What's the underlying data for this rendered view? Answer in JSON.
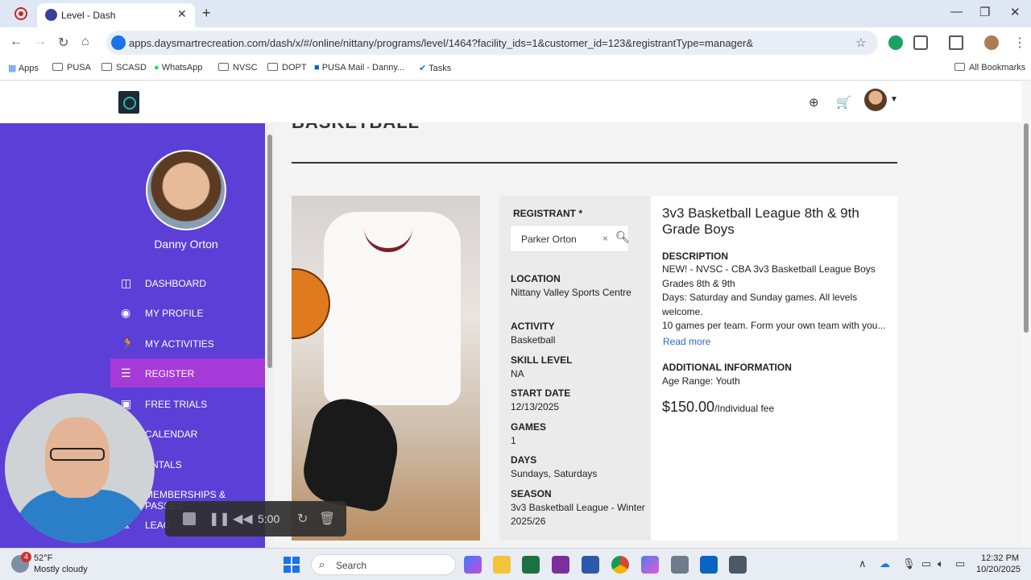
{
  "browser": {
    "tab_title": "Level - Dash",
    "url": "apps.daysmartrecreation.com/dash/x/#/online/nittany/programs/level/1464?facility_ids=1&customer_id=123&registrantType=manager&",
    "bookmarks": [
      "Apps",
      "PUSA",
      "SCASD",
      "WhatsApp",
      "NVSC",
      "DOPT",
      "PUSA Mail - Danny...",
      "Tasks"
    ],
    "all_bookmarks": "All Bookmarks"
  },
  "sidebar": {
    "user_name": "Danny Orton",
    "items": [
      {
        "label": "DASHBOARD"
      },
      {
        "label": "MY PROFILE"
      },
      {
        "label": "MY ACTIVITIES"
      },
      {
        "label": "REGISTER"
      },
      {
        "label": "FREE TRIALS"
      },
      {
        "label": "CALENDAR"
      },
      {
        "label": "ENTALS"
      },
      {
        "label": "MEMBERSHIPS & PASSES"
      },
      {
        "label": "LEAG"
      }
    ]
  },
  "main": {
    "section_title": "BASKETBALL"
  },
  "registrant": {
    "label": "REGISTRANT *",
    "value": "Parker Orton",
    "clear": "×",
    "fields": [
      {
        "label": "LOCATION",
        "value": "Nittany Valley Sports Centre"
      },
      {
        "label": "ACTIVITY",
        "value": "Basketball"
      },
      {
        "label": "SKILL LEVEL",
        "value": "NA"
      },
      {
        "label": "START DATE",
        "value": "12/13/2025"
      },
      {
        "label": "GAMES",
        "value": "1"
      },
      {
        "label": "DAYS",
        "value": "Sundays, Saturdays"
      },
      {
        "label": "SEASON",
        "value": "3v3 Basketball League - Winter 2025/26"
      }
    ]
  },
  "program": {
    "title": "3v3 Basketball League 8th & 9th Grade Boys",
    "description_label": "DESCRIPTION",
    "description": "NEW! - NVSC - CBA 3v3 Basketball League Boys Grades 8th & 9th\nDays: Saturday and Sunday games. All levels welcome.\n10 games per team. Form your own team with you...",
    "read_more": "Read more",
    "additional_label": "ADDITIONAL INFORMATION",
    "additional_value": "Age Range: Youth",
    "price": "$150.00",
    "price_suffix": "/Individual fee"
  },
  "recorder": {
    "time": "5:00"
  },
  "taskbar": {
    "weather_temp": "52°F",
    "weather_desc": "Mostly cloudy",
    "weather_badge": "4",
    "search_placeholder": "Search",
    "time": "12:32 PM",
    "date": "10/20/2025"
  }
}
